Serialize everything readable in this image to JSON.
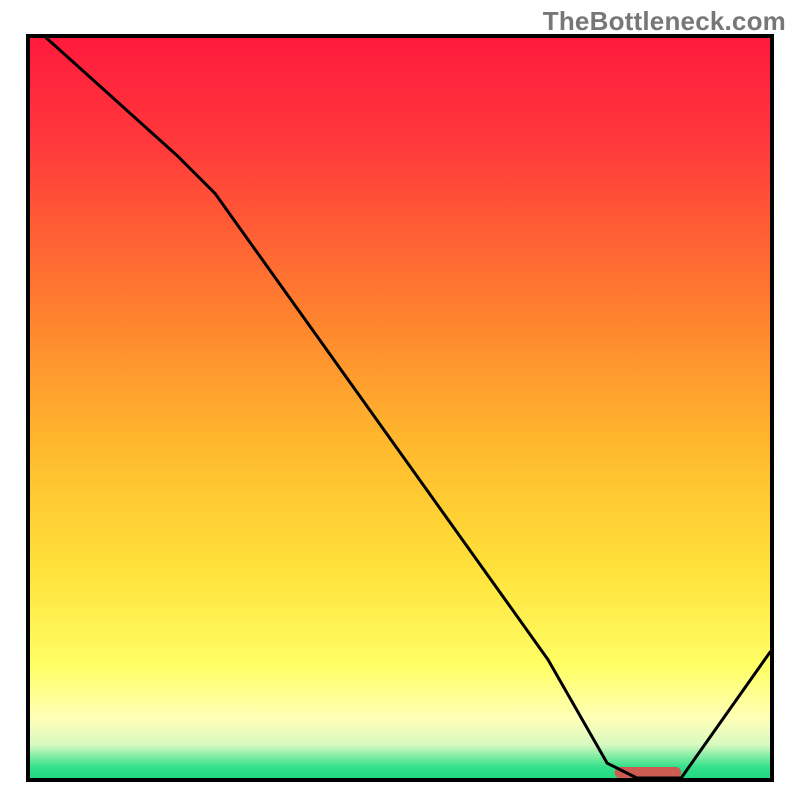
{
  "watermark": "TheBottleneck.com",
  "chart_data": {
    "type": "line",
    "title": "",
    "xlabel": "",
    "ylabel": "",
    "xlim": [
      0,
      100
    ],
    "ylim": [
      0,
      100
    ],
    "series": [
      {
        "name": "curve",
        "x": [
          0,
          10,
          20,
          25,
          30,
          40,
          50,
          60,
          70,
          78,
          82,
          88,
          100
        ],
        "y": [
          102,
          93,
          84,
          79,
          72,
          58,
          44,
          30,
          16,
          2,
          0,
          0,
          17
        ]
      }
    ],
    "marker": {
      "name": "target-range",
      "x_start": 79,
      "x_end": 88,
      "y": 0,
      "color": "#cc5b52"
    },
    "background_gradient": {
      "stops": [
        {
          "offset": 0.0,
          "color": "#ff1a3c"
        },
        {
          "offset": 0.15,
          "color": "#ff3b3b"
        },
        {
          "offset": 0.35,
          "color": "#ff7a2f"
        },
        {
          "offset": 0.55,
          "color": "#ffb92d"
        },
        {
          "offset": 0.72,
          "color": "#ffe23a"
        },
        {
          "offset": 0.85,
          "color": "#ffff66"
        },
        {
          "offset": 0.92,
          "color": "#ffffb8"
        },
        {
          "offset": 0.955,
          "color": "#d8f9c0"
        },
        {
          "offset": 0.985,
          "color": "#34e18a"
        },
        {
          "offset": 1.0,
          "color": "#1fd97e"
        }
      ]
    }
  }
}
